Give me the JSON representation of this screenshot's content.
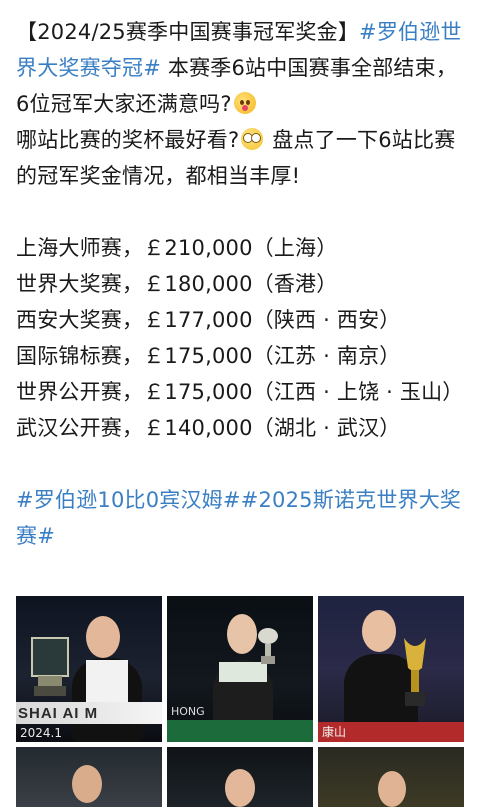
{
  "post": {
    "intro_bracket_title": "【2024/25赛季中国赛事冠军奖金】",
    "intro_hashtag": "#罗伯逊世界大奖赛夺冠#",
    "intro_text_1": " 本赛季6站中国赛事全部结束，6位冠军大家还满意吗?",
    "intro_text_2": "哪站比赛的奖杯最好看?",
    "intro_text_3": " 盘点了一下6站比赛的冠军奖金情况，都相当丰厚!",
    "prizes": [
      "上海大师赛，￡210,000（上海）",
      "世界大奖赛，￡180,000（香港）",
      "西安大奖赛，￡177,000（陕西 · 西安）",
      "国际锦标赛，￡175,000（江苏 · 南京）",
      "世界公开赛，￡175,000（江西 · 上饶 · 玉山）",
      "武汉公开赛，￡140,000（湖北 · 武汉）"
    ],
    "tag_1": "#罗伯逊10比0宾汉姆#",
    "tag_2": "#2025斯诺克世界大奖赛#"
  },
  "photos": [
    {
      "banner": "SHAI   AI M",
      "sub": "2024.1"
    },
    {
      "banner": "HONG",
      "sub": ""
    },
    {
      "banner": "康山",
      "sub": ""
    },
    {
      "banner": "",
      "sub": ""
    },
    {
      "banner": "",
      "sub": ""
    },
    {
      "banner": "",
      "sub": ""
    }
  ],
  "icons": {
    "emoji_1": "blushing-face-icon",
    "emoji_2": "eyes-face-icon"
  }
}
